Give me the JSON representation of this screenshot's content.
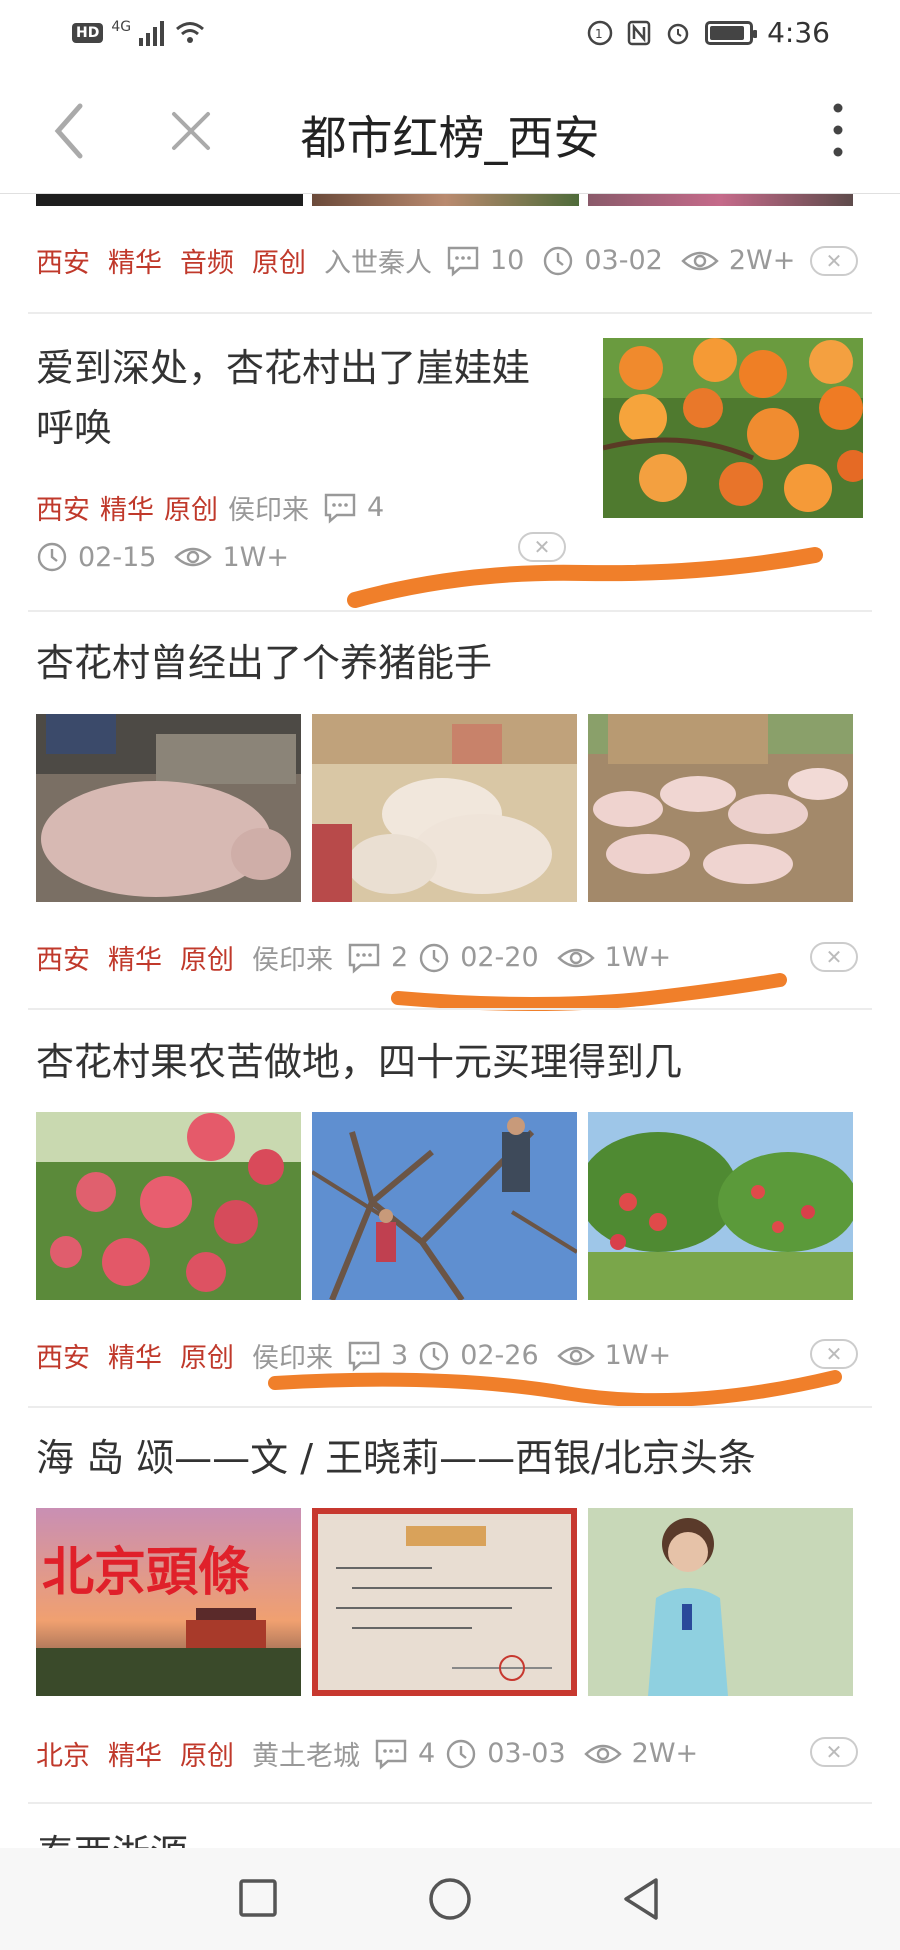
{
  "status_bar": {
    "hd": "HD",
    "network": "4G",
    "time": "4:36",
    "battery_level": 0.9
  },
  "nav": {
    "title": "都市红榜_西安",
    "back_icon": "chevron-left-icon",
    "close_icon": "close-icon",
    "more_icon": "more-vertical-icon"
  },
  "colors": {
    "tag": "#c0392b",
    "meta_gray": "#999999",
    "annotation": "#f07f2a"
  },
  "articles": [
    {
      "tags": [
        "西安",
        "精华",
        "音频",
        "原创"
      ],
      "author": "入世秦人",
      "comments": "10",
      "date": "03-02",
      "views": "2W+"
    },
    {
      "title_line1": "爱到深处，杏花村出了崖娃娃",
      "title_line2": "呼唤",
      "tags": [
        "西安",
        "精华",
        "原创"
      ],
      "author": "侯印来",
      "comments": "4",
      "date": "02-15",
      "views": "1W+"
    },
    {
      "title": "杏花村曾经出了个养猪能手",
      "tags": [
        "西安",
        "精华",
        "原创"
      ],
      "author": "侯印来",
      "comments": "2",
      "date": "02-20",
      "views": "1W+"
    },
    {
      "title": "杏花村果农苦做地，四十元买理得到几",
      "tags": [
        "西安",
        "精华",
        "原创"
      ],
      "author": "侯印来",
      "comments": "3",
      "date": "02-26",
      "views": "1W+"
    },
    {
      "title": "海 岛 颂——文 / 王晓莉——西银/北京头条",
      "tags": [
        "北京",
        "精华",
        "原创"
      ],
      "author": "黄土老城",
      "comments": "4",
      "date": "03-03",
      "views": "2W+",
      "image_text": "北京頭條"
    },
    {
      "title": "秦西浙源"
    }
  ],
  "system_nav": {
    "recent_icon": "square-icon",
    "home_icon": "circle-icon",
    "back_icon": "triangle-back-icon"
  }
}
